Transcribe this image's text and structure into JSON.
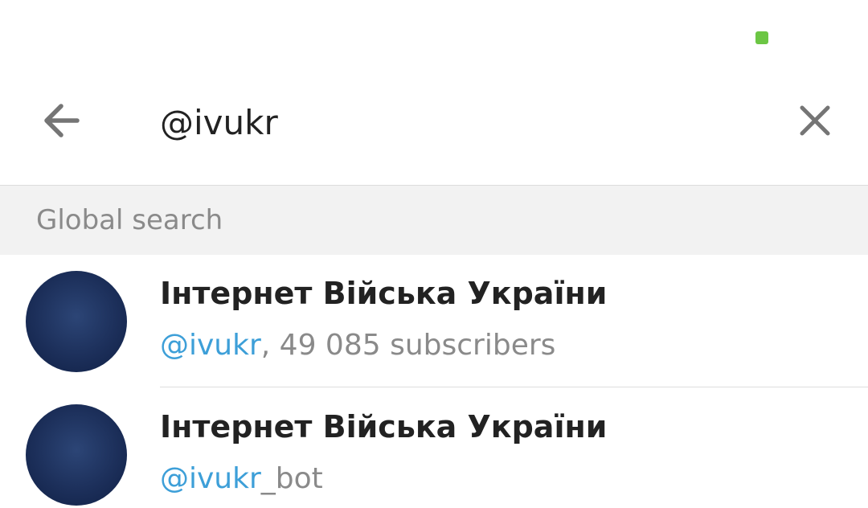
{
  "status_bar": {
    "indicator_color": "#6cc644"
  },
  "search": {
    "value": "@ivukr",
    "back_icon": "arrow-left-icon",
    "clear_icon": "close-icon"
  },
  "global_search": {
    "header": "Global search",
    "results": [
      {
        "title": "Інтернет Війська України",
        "match": "@ivukr",
        "rest": ", 49 085 subscribers"
      },
      {
        "title": "Інтернет Війська України",
        "match": "@ivukr",
        "rest": "_bot"
      }
    ]
  },
  "colors": {
    "link": "#3d9fd8",
    "secondary_text": "#8a8a8a",
    "primary_text": "#222222",
    "icon": "#757575",
    "header_bg": "#f2f2f2"
  }
}
